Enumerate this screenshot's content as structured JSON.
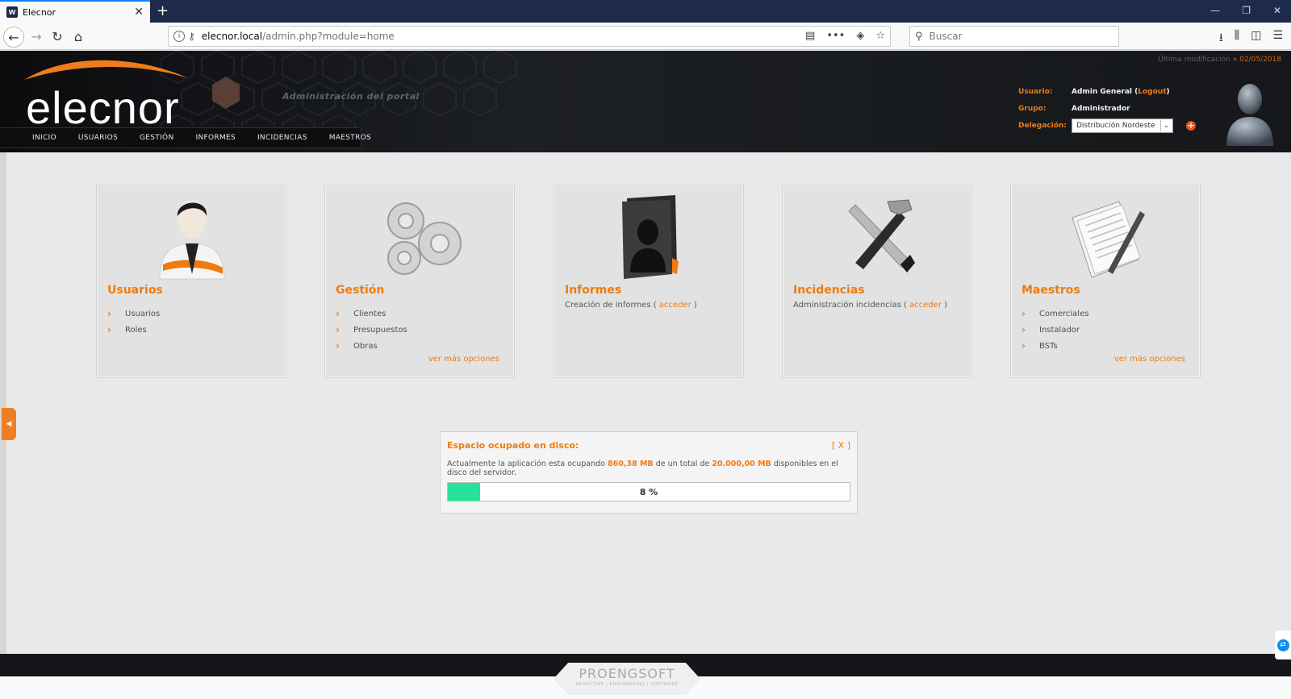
{
  "browser": {
    "tab_title": "Elecnor",
    "favicon_text": "W",
    "url_host": "elecnor.local",
    "url_path": "/admin.php?module=home",
    "search_placeholder": "Buscar"
  },
  "header": {
    "logo_text": "elecnor",
    "portal_label": "Administración del portal",
    "last_mod_label": "Última modificación",
    "last_mod_sep": "»",
    "last_mod_date": "02/05/2018",
    "nav": [
      "INICIO",
      "USUARIOS",
      "GESTIÓN",
      "INFORMES",
      "INCIDENCIAS",
      "MAESTROS"
    ],
    "user_label": "Usuario:",
    "user_name": "Admin General (",
    "logout": "Logout",
    "user_close": ")",
    "group_label": "Grupo:",
    "group_value": "Administrador",
    "deleg_label": "Delegación:",
    "deleg_value": "Distribución Nordeste",
    "add_symbol": "+"
  },
  "panels": {
    "usuarios": {
      "title": "Usuarios",
      "items": [
        "Usuarios",
        "Roles"
      ]
    },
    "gestion": {
      "title": "Gestión",
      "items": [
        "Clientes",
        "Presupuestos",
        "Obras"
      ],
      "more": "ver más opciones"
    },
    "informes": {
      "title": "Informes",
      "desc": "Creación de informes ( ",
      "link": "acceder",
      "close": " )"
    },
    "incidencias": {
      "title": "Incidencias",
      "desc": "Administración incidencias ( ",
      "link": "acceder",
      "close": " )"
    },
    "maestros": {
      "title": "Maestros",
      "items": [
        "Comerciales",
        "Instalador",
        "BSTs"
      ],
      "more": "ver más opciones"
    }
  },
  "disk": {
    "title": "Espacio ocupado en disco:",
    "close": "[ X ]",
    "text1": "Actualmente la aplicación esta ocupando ",
    "used": "860,38 MB",
    "text2": " de un total de ",
    "total": "20.000,00 MB",
    "text3": " disponibles en el disco del servidor.",
    "percent_label": "8 %",
    "percent_value": 8
  },
  "footer": {
    "brand": "PROENGSOFT",
    "brand_sub": "PROACTIVE | ENGINEERING | SOFTWARE"
  },
  "colors": {
    "accent": "#ee7b12",
    "progress": "#27e29a",
    "header_bg": "#15171a"
  }
}
